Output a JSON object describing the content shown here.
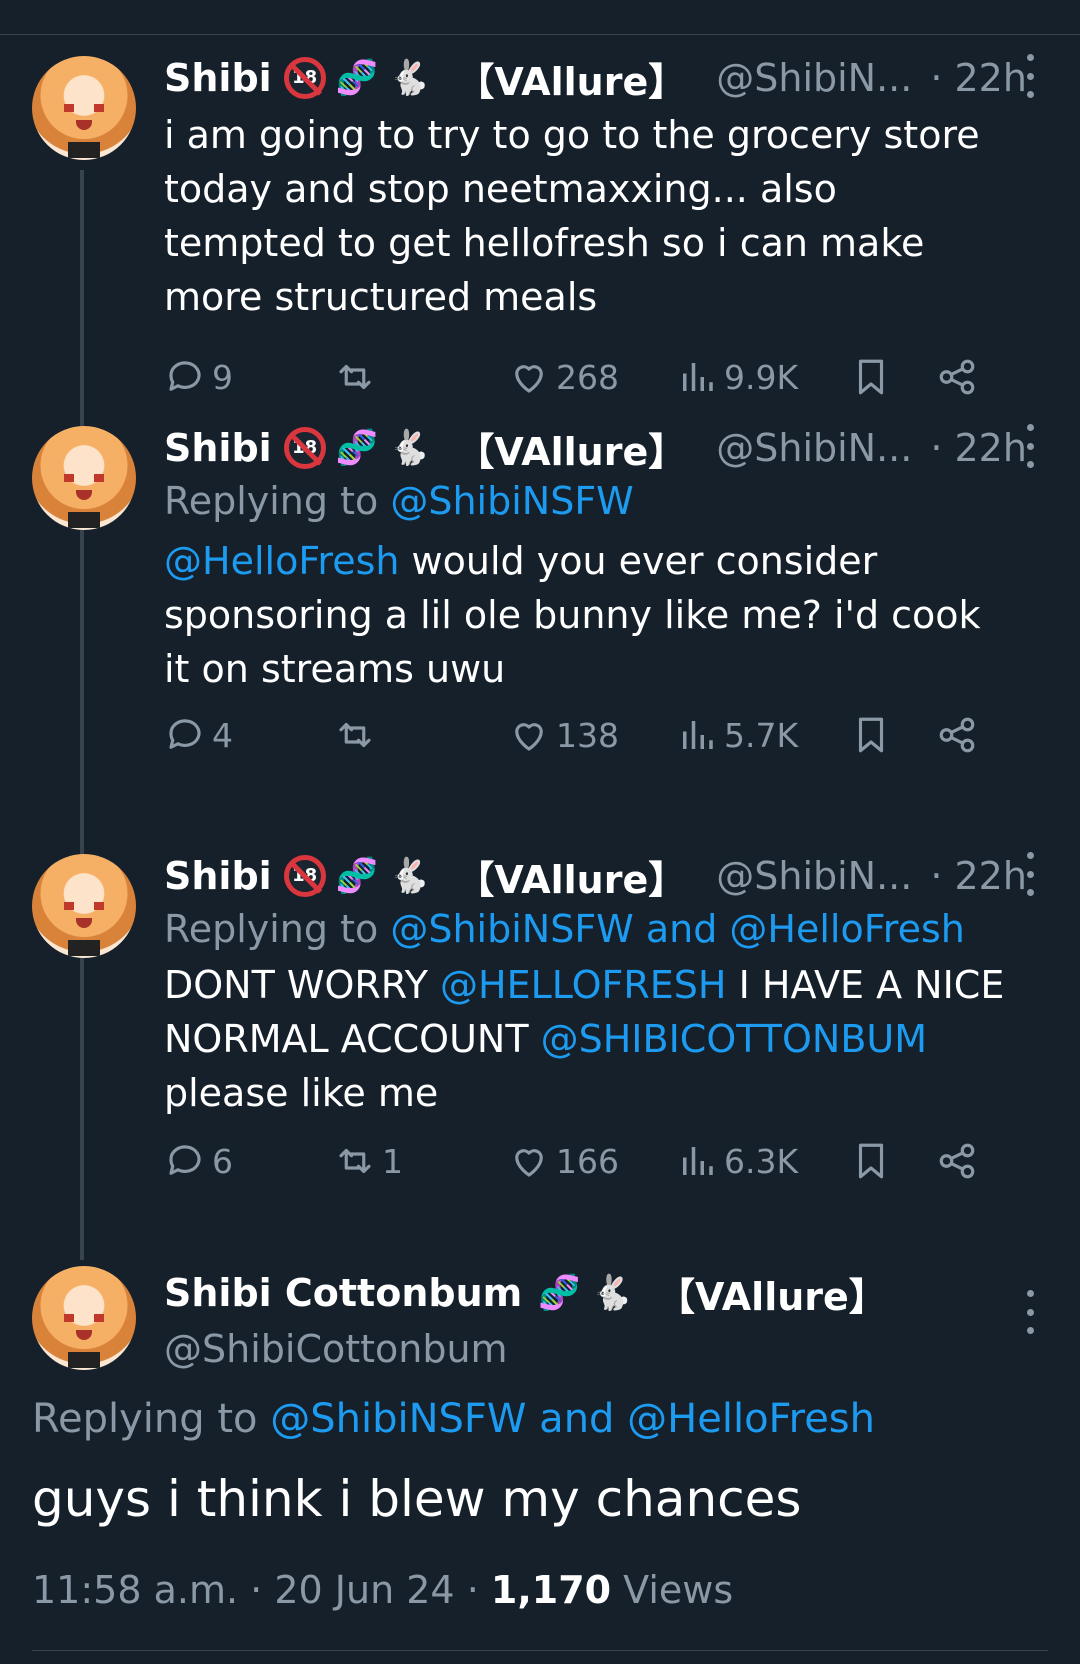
{
  "tweets": [
    {
      "name": "Shibi",
      "badge_18": "18",
      "tag": "【VAllure】",
      "handle": "@ShibiN...",
      "time": "· 22h",
      "reply_label": "",
      "reply_mentions": "",
      "mention": "",
      "text": "i am going to try to go to the grocery store today and stop neetmaxxing... also tempted to get hellofresh so i can make more structured meals",
      "replies": "9",
      "retweets": "",
      "likes": "268",
      "views": "9.9K"
    },
    {
      "name": "Shibi",
      "badge_18": "18",
      "tag": "【VAllure】",
      "handle": "@ShibiN...",
      "time": "· 22h",
      "reply_label": "Replying to",
      "reply_mentions": "@ShibiNSFW",
      "mention": "@HelloFresh",
      "text": " would you ever consider sponsoring a lil ole bunny like me? i'd cook it on streams uwu",
      "replies": "4",
      "retweets": "",
      "likes": "138",
      "views": "5.7K"
    },
    {
      "name": "Shibi",
      "badge_18": "18",
      "tag": "【VAllure】",
      "handle": "@ShibiN...",
      "time": "· 22h",
      "reply_label": "Replying to",
      "reply_mentions": "@ShibiNSFW and @HelloFresh",
      "text_parts": [
        "DONT WORRY ",
        "@HELLOFRESH",
        " I HAVE A NICE NORMAL ACCOUNT ",
        "@SHIBICOTTONBUM",
        " please like me"
      ],
      "replies": "6",
      "retweets": "1",
      "likes": "166",
      "views": "6.3K"
    }
  ],
  "main": {
    "name": "Shibi Cottonbum",
    "tag": "【VAllure】",
    "handle": "@ShibiCottonbum",
    "reply_label": "Replying to",
    "reply_mentions": "@ShibiNSFW and @HelloFresh",
    "text": "guys i think i blew my chances",
    "time": "11:58 a.m.",
    "date": "20 Jun 24",
    "views_count": "1,170",
    "views_label": "Views",
    "separator": "·"
  },
  "icons": {
    "reply": "reply-icon",
    "retweet": "retweet-icon",
    "like": "heart-icon",
    "views": "views-icon",
    "bookmark": "bookmark-icon",
    "share": "share-icon",
    "more": "more-icon"
  },
  "emoji": {
    "dna": "🧬",
    "bunny": "🐇"
  },
  "colors": {
    "background": "#15202b",
    "link": "#1d9bf0",
    "secondary": "#8b98a5",
    "divider": "#38444d"
  }
}
